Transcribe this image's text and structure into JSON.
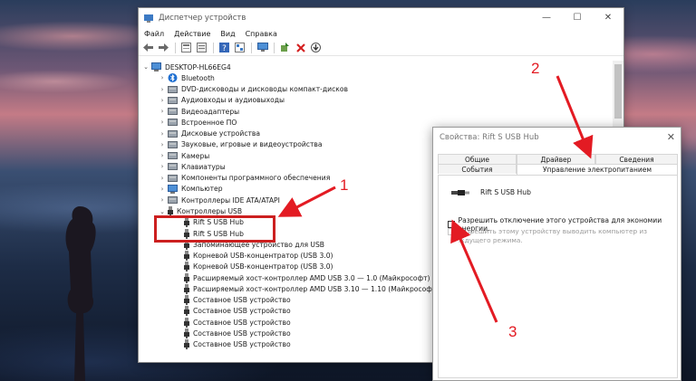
{
  "window": {
    "title": "Диспетчер устройств",
    "minimize": "—",
    "maximize": "☐",
    "close": "✕"
  },
  "menu": [
    "Файл",
    "Действие",
    "Вид",
    "Справка"
  ],
  "toolbar": [
    "back-icon",
    "forward-icon",
    "properties-icon",
    "list-icon",
    "help-icon",
    "view-icon",
    "monitor-icon",
    "update-driver-icon",
    "uninstall-icon",
    "scan-icon"
  ],
  "tree": [
    {
      "label": "DESKTOP-HL66EG4",
      "level": 0,
      "arrow": "⌄",
      "icon": "computer-icon"
    },
    {
      "label": "Bluetooth",
      "level": 1,
      "arrow": "›",
      "icon": "bluetooth-icon"
    },
    {
      "label": "DVD-дисководы и дисководы компакт-дисков",
      "level": 1,
      "arrow": "›",
      "icon": "dvd-icon"
    },
    {
      "label": "Аудиовходы и аудиовыходы",
      "level": 1,
      "arrow": "›",
      "icon": "audio-icon"
    },
    {
      "label": "Видеоадаптеры",
      "level": 1,
      "arrow": "›",
      "icon": "video-adapter-icon"
    },
    {
      "label": "Встроенное ПО",
      "level": 1,
      "arrow": "›",
      "icon": "firmware-icon"
    },
    {
      "label": "Дисковые устройства",
      "level": 1,
      "arrow": "›",
      "icon": "disk-icon"
    },
    {
      "label": "Звуковые, игровые и видеоустройства",
      "level": 1,
      "arrow": "›",
      "icon": "sound-icon"
    },
    {
      "label": "Камеры",
      "level": 1,
      "arrow": "›",
      "icon": "camera-icon"
    },
    {
      "label": "Клавиатуры",
      "level": 1,
      "arrow": "›",
      "icon": "keyboard-icon"
    },
    {
      "label": "Компоненты программного обеспечения",
      "level": 1,
      "arrow": "›",
      "icon": "software-icon"
    },
    {
      "label": "Компьютер",
      "level": 1,
      "arrow": "›",
      "icon": "computer-icon"
    },
    {
      "label": "Контроллеры IDE ATA/ATAPI",
      "level": 1,
      "arrow": "›",
      "icon": "ide-icon"
    },
    {
      "label": "Контроллеры USB",
      "level": 1,
      "arrow": "⌄",
      "icon": "usb-icon"
    },
    {
      "label": "Rift S USB Hub",
      "level": 2,
      "arrow": "",
      "icon": "usb-icon"
    },
    {
      "label": "Rift S USB Hub",
      "level": 2,
      "arrow": "",
      "icon": "usb-icon"
    },
    {
      "label": "Запоминающее устройство для USB",
      "level": 2,
      "arrow": "",
      "icon": "usb-icon"
    },
    {
      "label": "Корневой USB-концентратор (USB 3.0)",
      "level": 2,
      "arrow": "",
      "icon": "usb-icon"
    },
    {
      "label": "Корневой USB-концентратор (USB 3.0)",
      "level": 2,
      "arrow": "",
      "icon": "usb-icon"
    },
    {
      "label": "Расширяемый хост-контроллер AMD USB 3.0 — 1.0 (Майкрософт)",
      "level": 2,
      "arrow": "",
      "icon": "usb-icon"
    },
    {
      "label": "Расширяемый хост-контроллер AMD USB 3.10 — 1.10 (Майкрософт)",
      "level": 2,
      "arrow": "",
      "icon": "usb-icon"
    },
    {
      "label": "Составное USB устройство",
      "level": 2,
      "arrow": "",
      "icon": "usb-icon"
    },
    {
      "label": "Составное USB устройство",
      "level": 2,
      "arrow": "",
      "icon": "usb-icon"
    },
    {
      "label": "Составное USB устройство",
      "level": 2,
      "arrow": "",
      "icon": "usb-icon"
    },
    {
      "label": "Составное USB устройство",
      "level": 2,
      "arrow": "",
      "icon": "usb-icon"
    },
    {
      "label": "Составное USB устройство",
      "level": 2,
      "arrow": "",
      "icon": "usb-icon"
    }
  ],
  "dialog": {
    "title": "Свойства: Rift S USB Hub",
    "close": "✕",
    "tabs_row1": [
      "Общие",
      "Драйвер",
      "Сведения"
    ],
    "tabs_row2": [
      "События",
      "Управление электропитанием"
    ],
    "device_name": "Rift S USB Hub",
    "checkbox1_label": "Разрешить отключение этого устройства для экономии энергии.",
    "checkbox2_label": "Разрешить этому устройству выводить компьютер из ждущего режима."
  },
  "annotations": [
    "1",
    "2",
    "3"
  ],
  "colors": {
    "annotation": "#e31b23",
    "highlight": "#cc1f1f",
    "folder": "#4a7fc1"
  }
}
